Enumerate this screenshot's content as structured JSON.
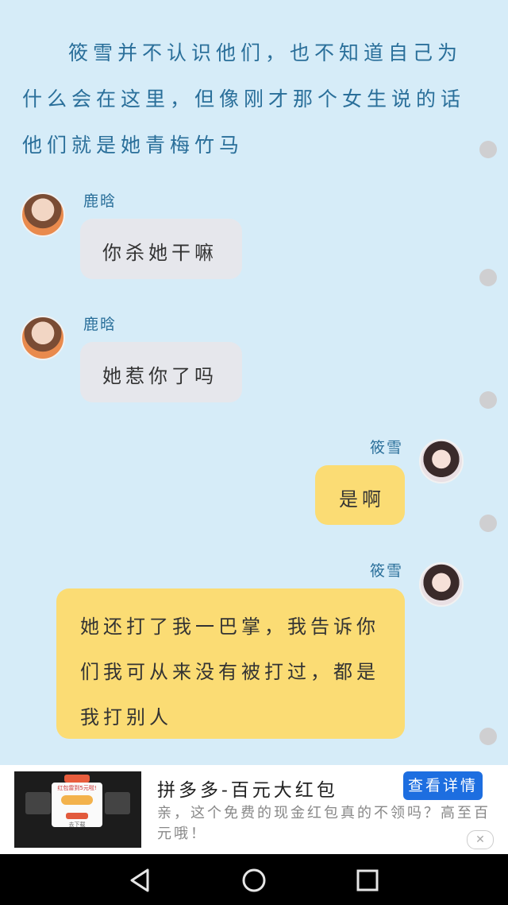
{
  "narration": "筱雪并不认识他们，也不知道自己为什么会在这里，但像刚才那个女生说的话他们就是她青梅竹马",
  "messages": [
    {
      "sender": "鹿晗",
      "text": "你杀她干嘛",
      "side": "left"
    },
    {
      "sender": "鹿晗",
      "text": "她惹你了吗",
      "side": "left"
    },
    {
      "sender": "筱雪",
      "text": "是啊",
      "side": "right"
    },
    {
      "sender": "筱雪",
      "text": "她还打了我一巴掌，我告诉你们我可从来没有被打过，都是我打别人",
      "side": "right"
    }
  ],
  "ad": {
    "thumb_texts": [
      "红包雷到5元啦!",
      "去下载"
    ],
    "title": "拼多多-百元大红包",
    "description": "亲，这个免费的现金红包真的不领吗？高至百元哦！",
    "button_label": "查看详情",
    "close_label": "✕"
  },
  "navbar": {
    "back": "back-icon",
    "home": "home-icon",
    "recents": "recents-icon"
  }
}
